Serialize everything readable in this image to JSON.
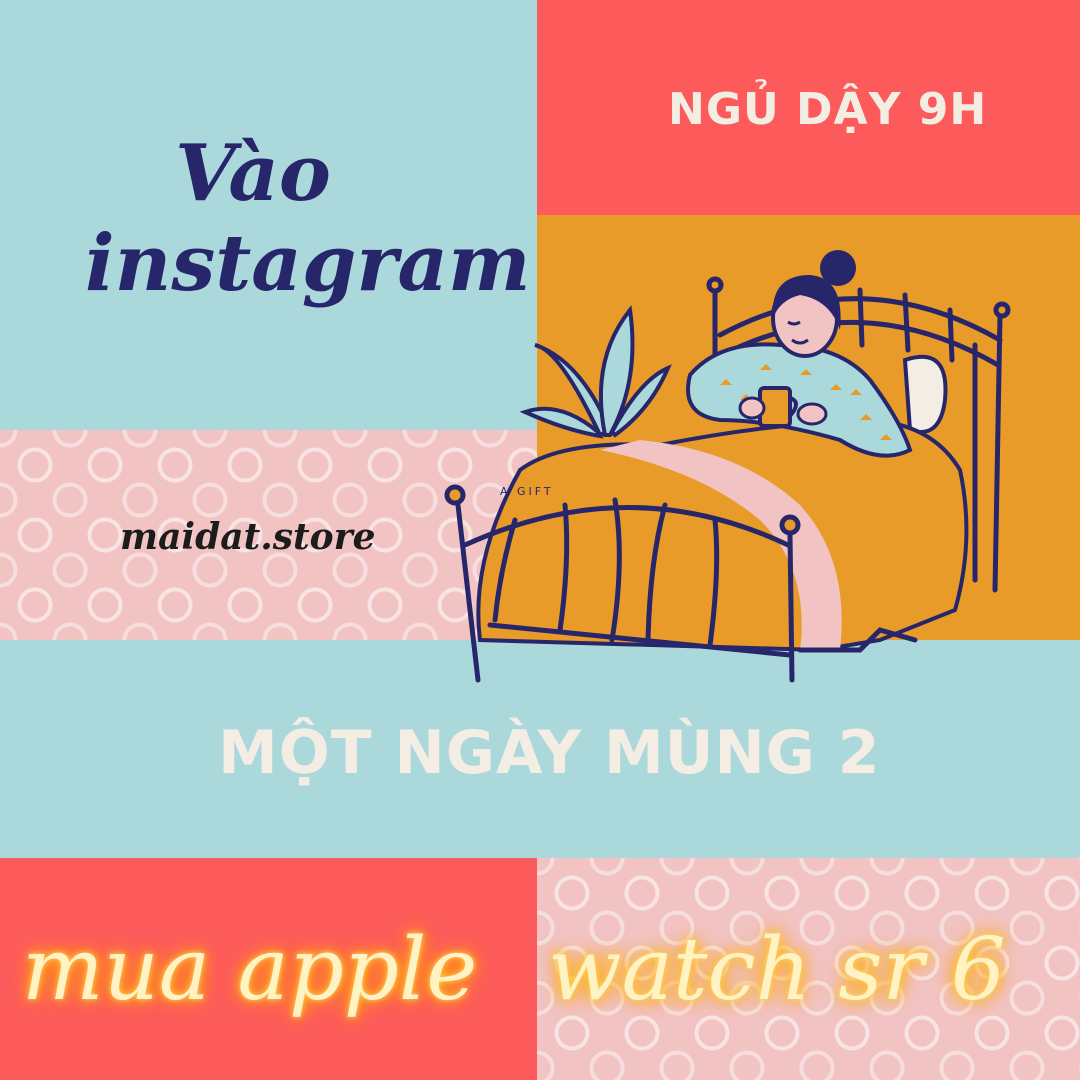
{
  "poster": {
    "title_line1": "Vào",
    "title_line2": "instagram",
    "wake_up": "NGỦ DẬY 9H",
    "store": "maidat.store",
    "gift_tag": "A GIFT",
    "day": "MỘT NGÀY MÙNG 2",
    "buy_part1": "mua apple",
    "buy_part2": "watch sr 6"
  },
  "colors": {
    "mint": "#abd8db",
    "coral": "#fd5b5b",
    "mustard": "#e89b29",
    "pink": "#f1c3c3",
    "navy": "#27266a",
    "cream": "#f3ede4"
  }
}
